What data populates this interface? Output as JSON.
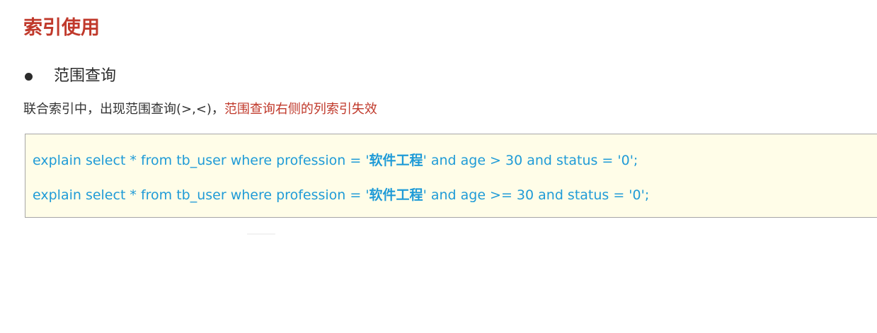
{
  "title": "索引使用",
  "bullet": {
    "text": "范围查询"
  },
  "description": {
    "normal": "联合索引中，出现范围查询(>,<)，",
    "highlight": "范围查询右侧的列索引失效"
  },
  "code": {
    "lines": [
      {
        "before": "explain  select  *  from  tb_user  where  profession = '",
        "value": "软件工程",
        "after": "'  and  age > 30  and  status = '0';"
      },
      {
        "before": "explain  select  *  from  tb_user  where  profession = '",
        "value": "软件工程",
        "after": "'  and  age >= 30  and  status = '0';"
      }
    ]
  },
  "colors": {
    "title": "#c0392b",
    "highlight": "#c0392b",
    "code_text": "#1f9bd7",
    "code_background": "#fffde8"
  }
}
